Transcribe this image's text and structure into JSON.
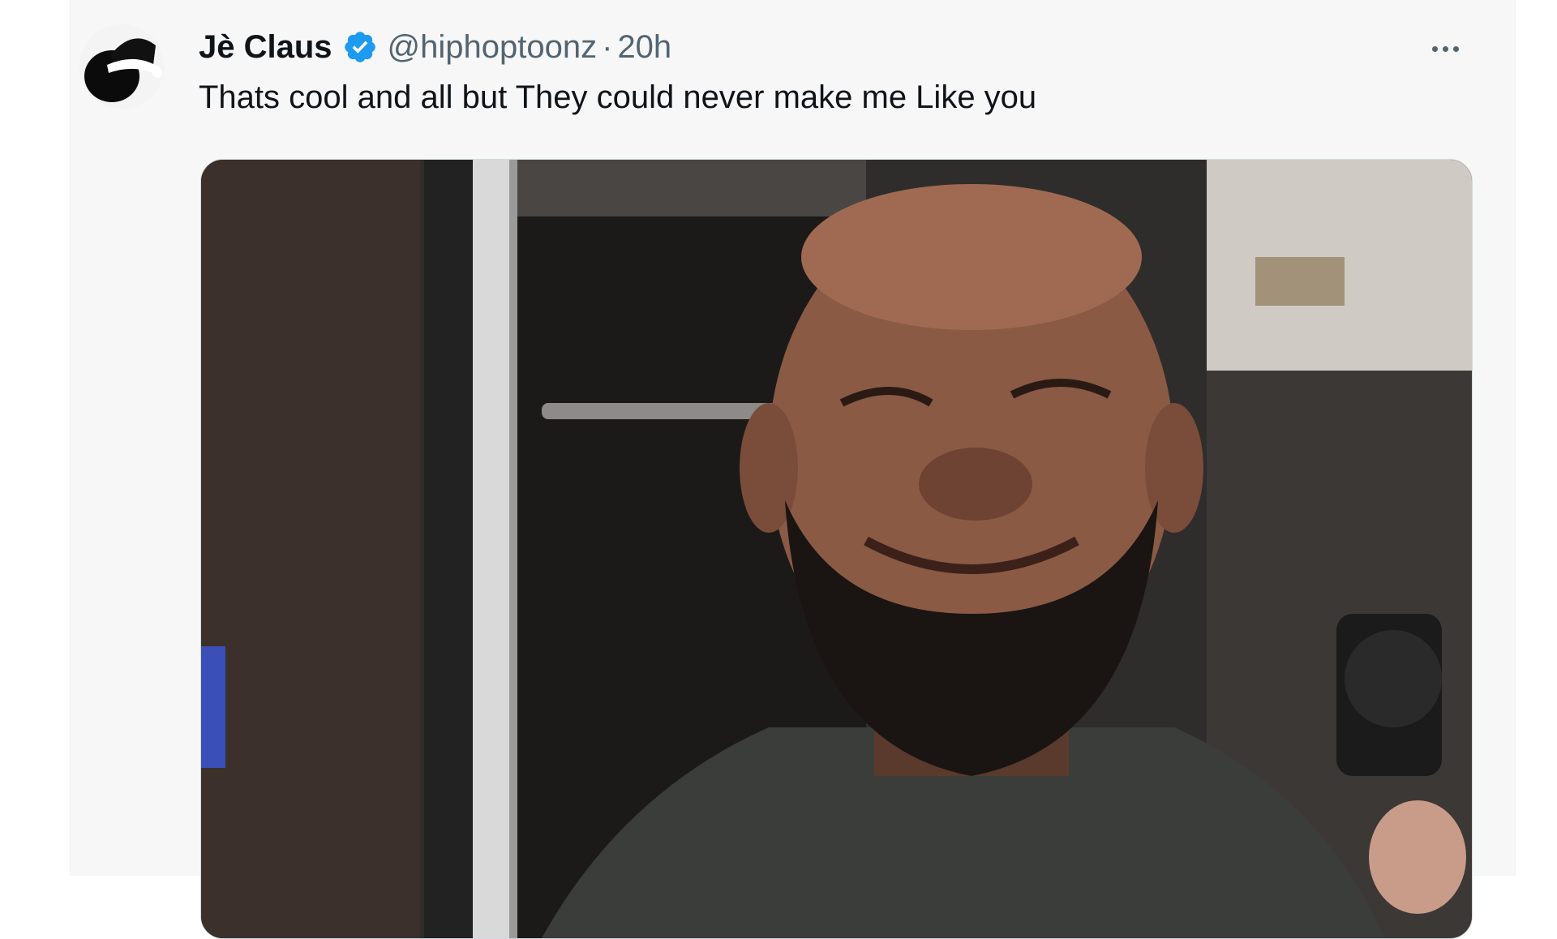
{
  "tweet": {
    "display_name": "Jè Claus",
    "verified": true,
    "handle": "@hiphoptoonz",
    "separator": "·",
    "time": "20h",
    "text": "Thats cool and all but They could never make me Like you",
    "more_icon": "more-horizontal-icon",
    "media_alt": "photo of a smiling bearded man in a locker room"
  },
  "colors": {
    "card_bg": "#f7f7f7",
    "primary_text": "#0f1419",
    "secondary_text": "#536471",
    "verified_blue": "#1d9bf0"
  }
}
